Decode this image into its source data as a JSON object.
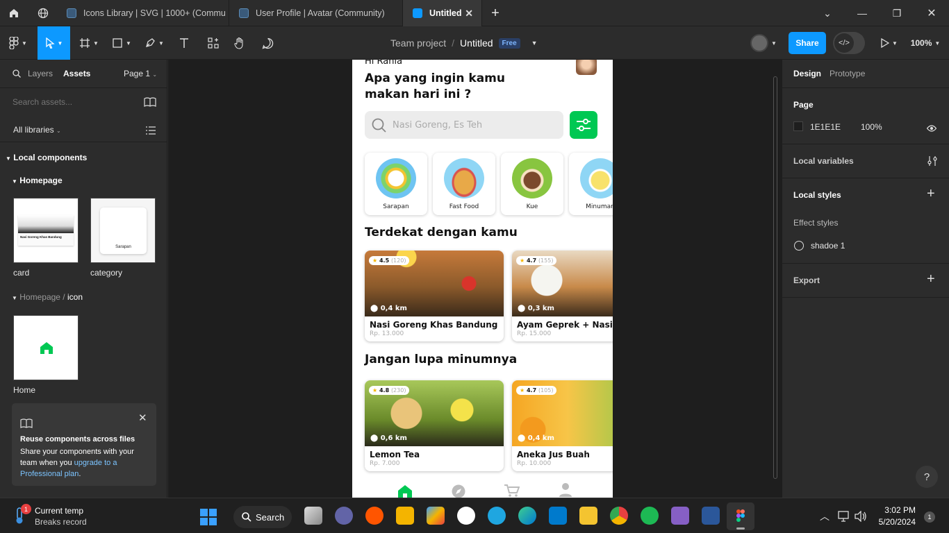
{
  "tabs": [
    {
      "label": "Icons Library | SVG | 1000+ (Commu"
    },
    {
      "label": "User Profile | Avatar (Community)"
    },
    {
      "label": "Untitled"
    }
  ],
  "toolbar": {
    "project": "Team project",
    "separator": "/",
    "file": "Untitled",
    "plan_badge": "Free",
    "share": "Share",
    "zoom": "100%"
  },
  "left": {
    "tab_layers": "Layers",
    "tab_assets": "Assets",
    "page": "Page 1",
    "search_placeholder": "Search assets...",
    "libraries": "All libraries",
    "local_components": "Local components",
    "homepage": "Homepage",
    "card_label": "card",
    "category_label": "category",
    "thumb_card_title": "Nasi Goreng Khas Bandung",
    "thumb_category_text": "Sarapan",
    "homepage_icon_prefix": "Homepage /",
    "homepage_icon_suffix": "icon",
    "home_label": "Home",
    "promo_title": "Reuse components across files",
    "promo_text": "Share your components with your team when you",
    "promo_link": "upgrade to a Professional plan",
    "promo_end": "."
  },
  "phone": {
    "greeting": "Hi Rania",
    "headline_1": "Apa yang ingin kamu",
    "headline_2": "makan hari ini ?",
    "search_placeholder": "Nasi Goreng, Es Teh",
    "categories": [
      "Sarapan",
      "Fast Food",
      "Kue",
      "Minuman"
    ],
    "section_nearby": "Terdekat dengan kamu",
    "section_drinks": "Jangan lupa minumnya",
    "nearby": [
      {
        "rating": "4.5",
        "count": "(120)",
        "dist": "0,4 km",
        "name": "Nasi Goreng Khas Bandung",
        "price": "Rp. 13.000"
      },
      {
        "rating": "4.7",
        "count": "(155)",
        "dist": "0,3 km",
        "name": "Ayam Geprek + Nasi",
        "price": "Rp. 15.000"
      }
    ],
    "drinks": [
      {
        "rating": "4.8",
        "count": "(230)",
        "dist": "0,6 km",
        "name": "Lemon Tea",
        "price": "Rp. 7.000"
      },
      {
        "rating": "4.7",
        "count": "(105)",
        "dist": "0,4 km",
        "name": "Aneka Jus Buah",
        "price": "Rp. 10.000"
      }
    ]
  },
  "right": {
    "tab_design": "Design",
    "tab_prototype": "Prototype",
    "page_title": "Page",
    "page_color": "1E1E1E",
    "page_opacity": "100%",
    "local_variables": "Local variables",
    "local_styles": "Local styles",
    "effect_styles": "Effect styles",
    "effect_name": "shadoe 1",
    "export": "Export"
  },
  "taskbar": {
    "weather_title": "Current temp",
    "weather_sub": "Breaks record",
    "weather_badge": "1",
    "search": "Search",
    "time": "3:02 PM",
    "date": "5/20/2024",
    "notif": "1"
  },
  "colors": {
    "accent": "#0d99ff",
    "green": "#00c853",
    "canvas": "#1E1E1E"
  }
}
